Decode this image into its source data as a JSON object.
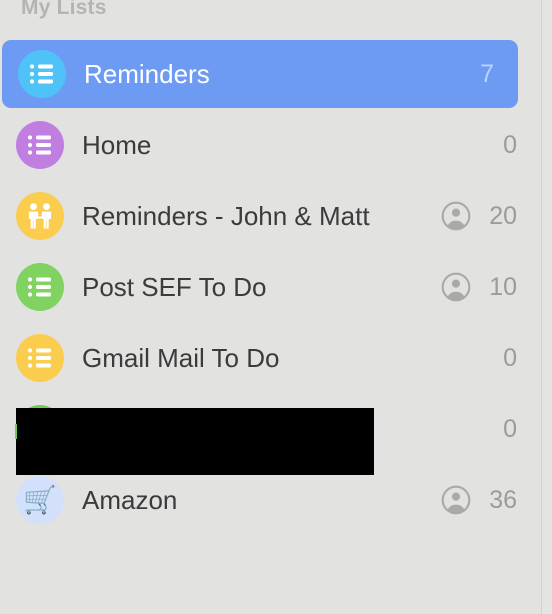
{
  "sidebar": {
    "header": "My Lists",
    "rows": [
      {
        "name": "Reminders",
        "count": "7",
        "icon": "list-icon",
        "icon_color": "#4fc3f7",
        "shared": false,
        "selected": true,
        "redacted": false
      },
      {
        "name": "Home",
        "count": "0",
        "icon": "list-icon",
        "icon_color": "#c07fe0",
        "shared": false,
        "selected": false,
        "redacted": false
      },
      {
        "name": "Reminders - John & Matt",
        "count": "20",
        "icon": "two-people-icon",
        "icon_color": "#fbcd4e",
        "shared": true,
        "selected": false,
        "redacted": false
      },
      {
        "name": "Post SEF To Do",
        "count": "10",
        "icon": "list-icon",
        "icon_color": "#80d360",
        "shared": true,
        "selected": false,
        "redacted": false
      },
      {
        "name": "Gmail Mail To Do",
        "count": "0",
        "icon": "list-icon",
        "icon_color": "#fbcd4e",
        "shared": false,
        "selected": false,
        "redacted": false
      },
      {
        "name": "",
        "count": "0",
        "icon": "list-icon",
        "icon_color": "#6fce4f",
        "shared": false,
        "selected": false,
        "redacted": true
      },
      {
        "name": "Amazon",
        "count": "36",
        "icon": "shopping-cart-icon",
        "icon_glyph": "🛒",
        "icon_color": "#d3e0fb",
        "shared": true,
        "selected": false,
        "redacted": false
      }
    ]
  },
  "colors": {
    "background": "#e2e2e0",
    "selection": "#6d9bf4",
    "label_text": "#3b3b3b",
    "count_text": "#9b9b99",
    "header_text": "#b4b4b2",
    "selected_text": "#ffffff",
    "selected_count_text": "#bdd1fa",
    "shared_badge": "#a9a9a7",
    "redaction": "#000000"
  }
}
